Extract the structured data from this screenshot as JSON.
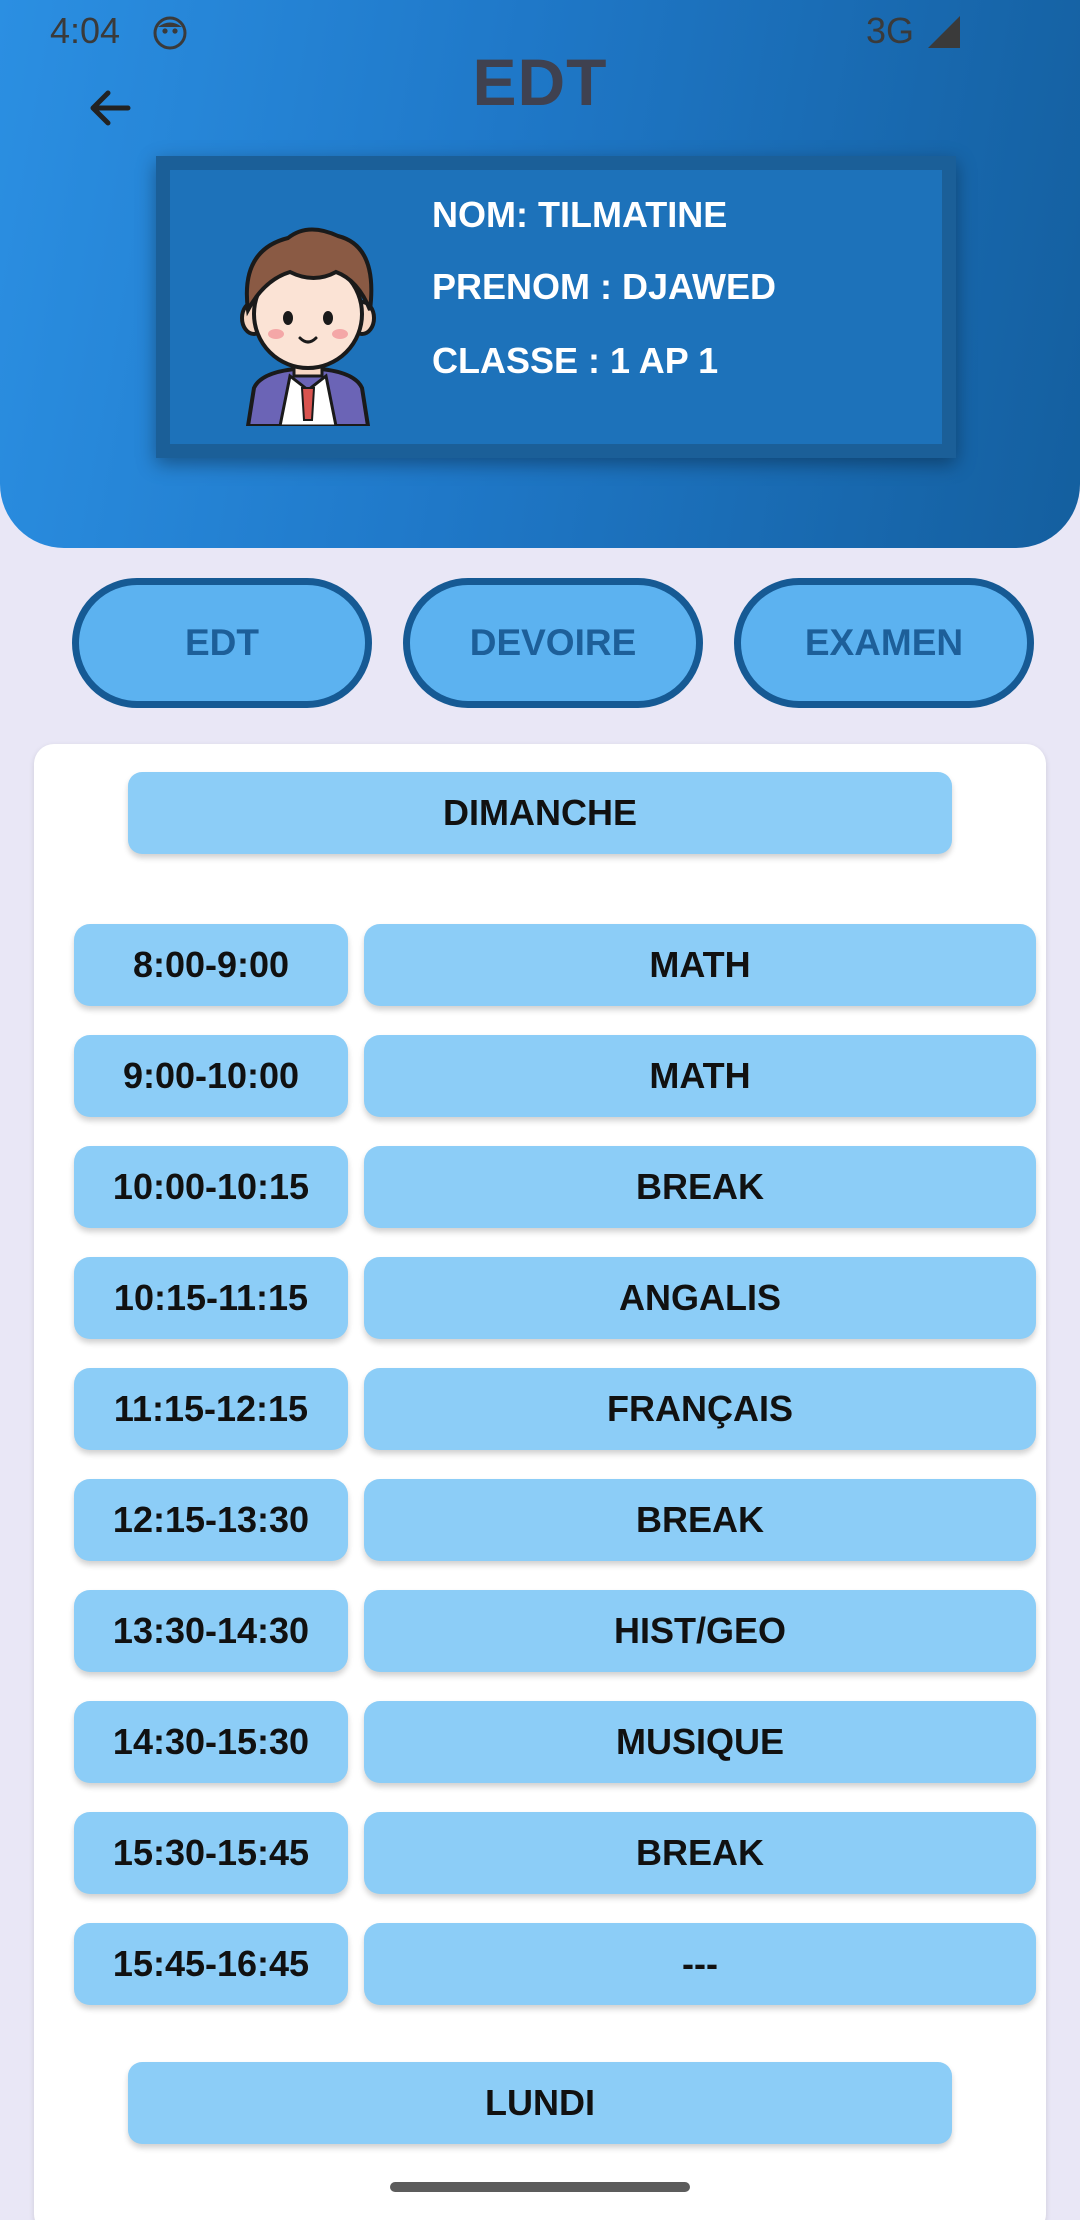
{
  "status_bar": {
    "time": "4:04",
    "network": "3G",
    "face_icon": "status-face-icon",
    "signal_icon": "signal-icon"
  },
  "header": {
    "title": "EDT",
    "back_icon": "arrow-left-icon",
    "colors": {
      "gradient_start": "#2b8fe2",
      "gradient_end": "#145f9f"
    }
  },
  "profile": {
    "avatar_icon": "student-avatar",
    "nom": "NOM: TILMATINE",
    "prenom": "PRENOM : DJAWED",
    "classe": "CLASSE : 1 AP 1"
  },
  "tabs": [
    {
      "label": "EDT"
    },
    {
      "label": "DEVOIRE"
    },
    {
      "label": "EXAMEN"
    }
  ],
  "schedule": {
    "days": [
      {
        "name": "DIMANCHE",
        "slots": [
          {
            "time": "8:00-9:00",
            "subject": "MATH"
          },
          {
            "time": "9:00-10:00",
            "subject": "MATH"
          },
          {
            "time": "10:00-10:15",
            "subject": "BREAK"
          },
          {
            "time": "10:15-11:15",
            "subject": "ANGALIS"
          },
          {
            "time": "11:15-12:15",
            "subject": "FRANÇAIS"
          },
          {
            "time": "12:15-13:30",
            "subject": "BREAK"
          },
          {
            "time": "13:30-14:30",
            "subject": "HIST/GEO"
          },
          {
            "time": "14:30-15:30",
            "subject": "MUSIQUE"
          },
          {
            "time": "15:30-15:45",
            "subject": "BREAK"
          },
          {
            "time": "15:45-16:45",
            "subject": "---"
          }
        ]
      },
      {
        "name": "LUNDI",
        "slots": []
      }
    ],
    "colors": {
      "cell": "#8ccdf7",
      "card": "#ffffff"
    }
  }
}
